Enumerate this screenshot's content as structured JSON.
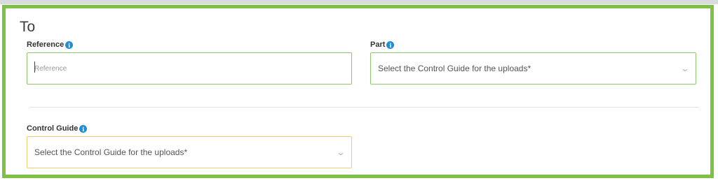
{
  "section": {
    "title": "To"
  },
  "reference": {
    "label": "Reference",
    "info_icon": "info-icon",
    "placeholder": "Reference",
    "value": ""
  },
  "part": {
    "label": "Part",
    "info_icon": "info-icon",
    "selected": "Select the Control Guide for the uploads*"
  },
  "control_guide": {
    "label": "Control Guide",
    "info_icon": "info-icon",
    "selected": "Select the Control Guide for the uploads*"
  },
  "colors": {
    "frame": "#7dc242",
    "input_border_green": "#8cc66d",
    "input_border_yellow": "#f2cd6a",
    "info_icon": "#1e8fd6"
  }
}
